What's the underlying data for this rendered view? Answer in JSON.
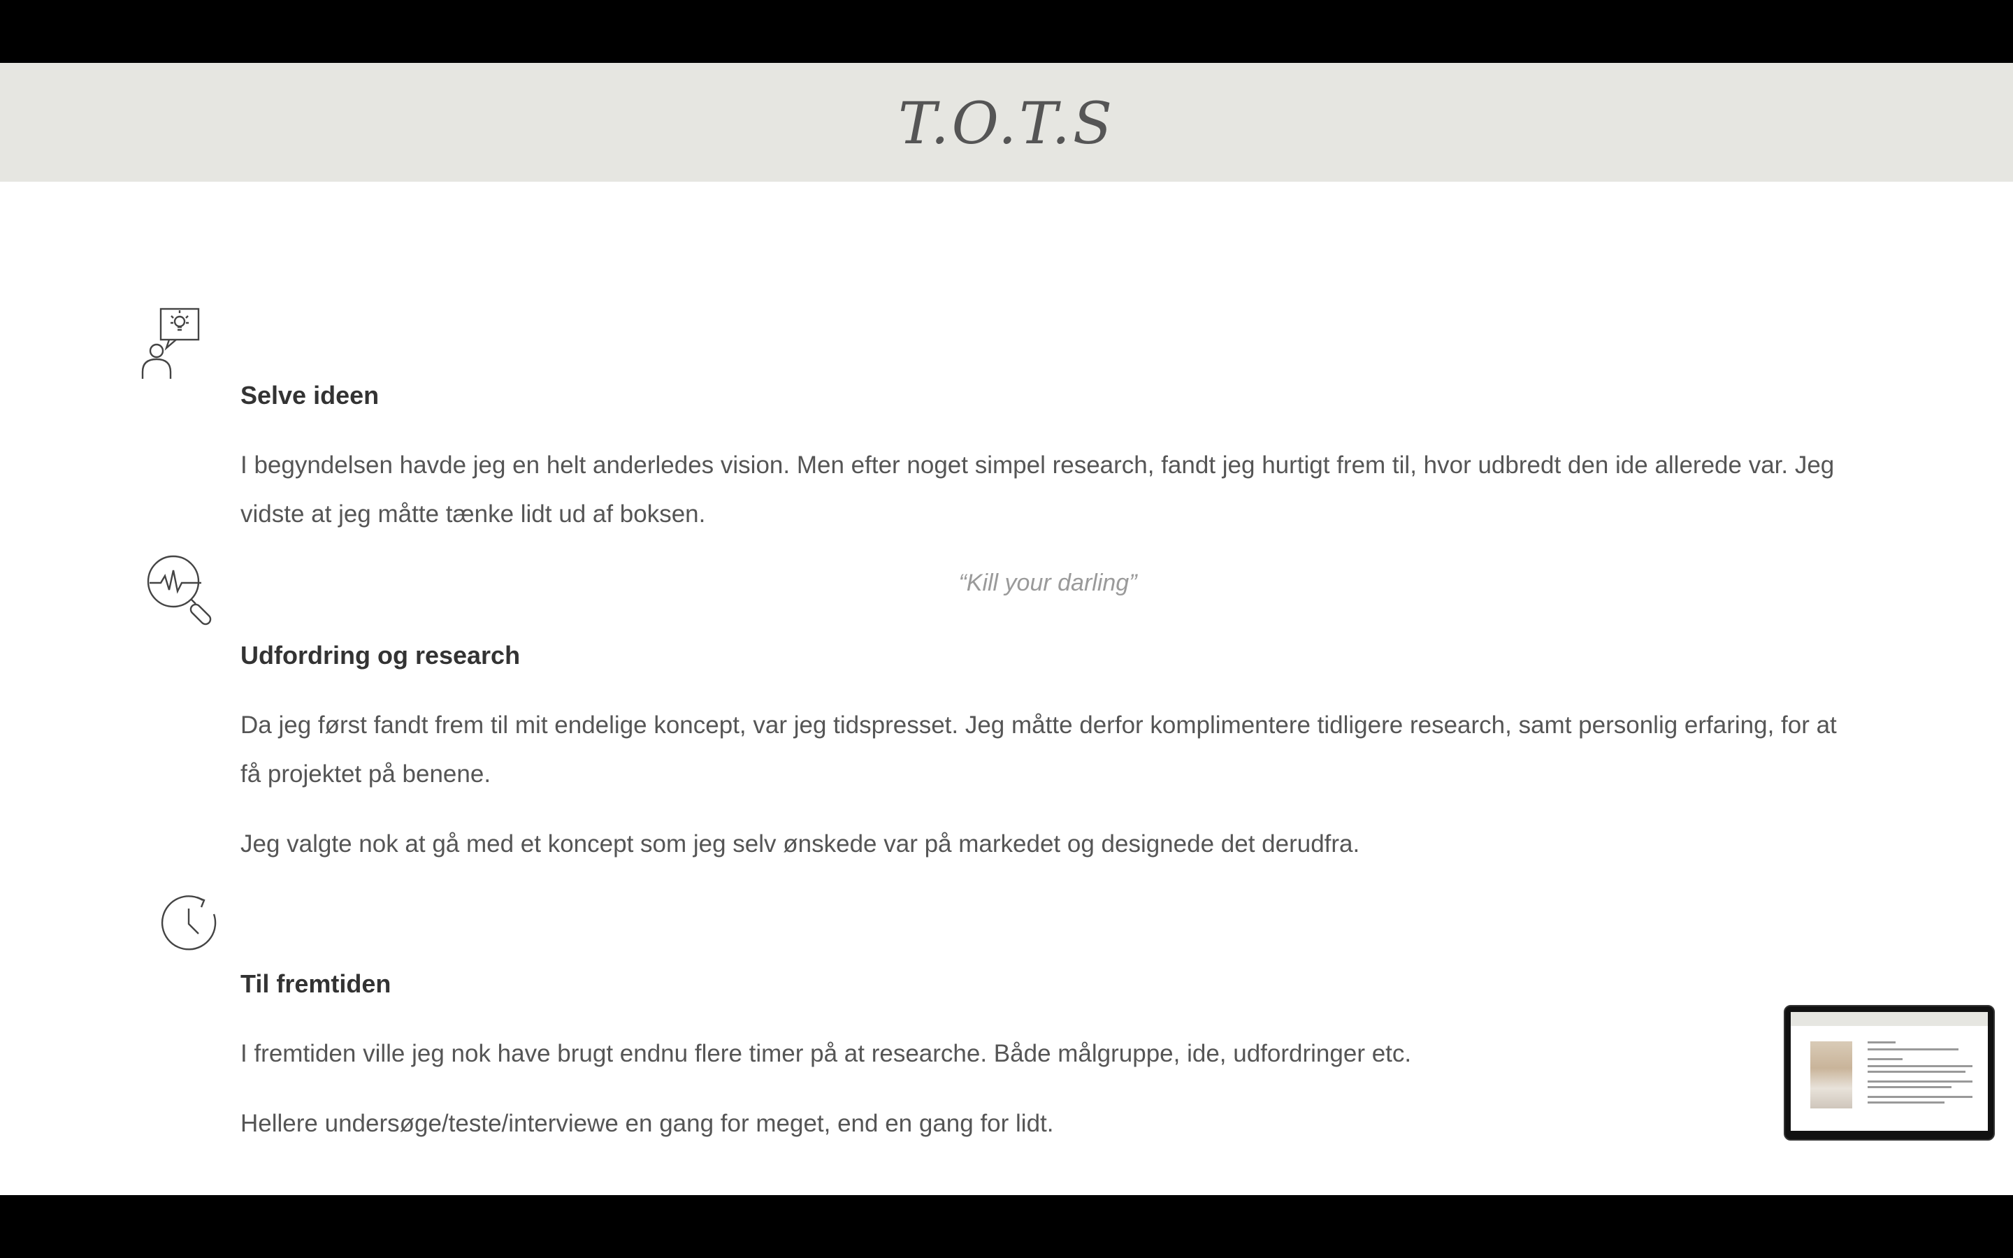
{
  "header": {
    "title": "T.O.T.S"
  },
  "sections": [
    {
      "icon": "person-idea-icon",
      "heading": "Selve ideen",
      "paragraphs": [
        "I begyndelsen havde jeg en helt anderledes vision. Men efter noget simpel research, fandt jeg hurtigt frem til, hvor udbredt den ide allerede var. Jeg vidste at jeg måtte tænke lidt ud af boksen."
      ]
    },
    {
      "icon": "magnifier-pulse-icon",
      "heading": "Udfordring og research",
      "paragraphs": [
        "Da jeg først fandt frem til mit endelige koncept, var jeg tidspresset. Jeg måtte derfor komplimentere tidligere research, samt personlig erfaring, for at få projektet på benene.",
        "Jeg valgte nok at gå med et koncept som jeg selv ønskede var på markedet og designede det derudfra."
      ]
    },
    {
      "icon": "clock-arrow-icon",
      "heading": "Til fremtiden",
      "paragraphs": [
        "I fremtiden ville jeg nok have brugt endnu flere timer på at researche. Både målgruppe, ide, udfordringer etc.",
        "Hellere undersøge/teste/interviewe en gang for meget, end en gang for lidt."
      ]
    }
  ],
  "quote": "“Kill your darling”",
  "thumbnail": {
    "label": "slide-thumbnail"
  }
}
